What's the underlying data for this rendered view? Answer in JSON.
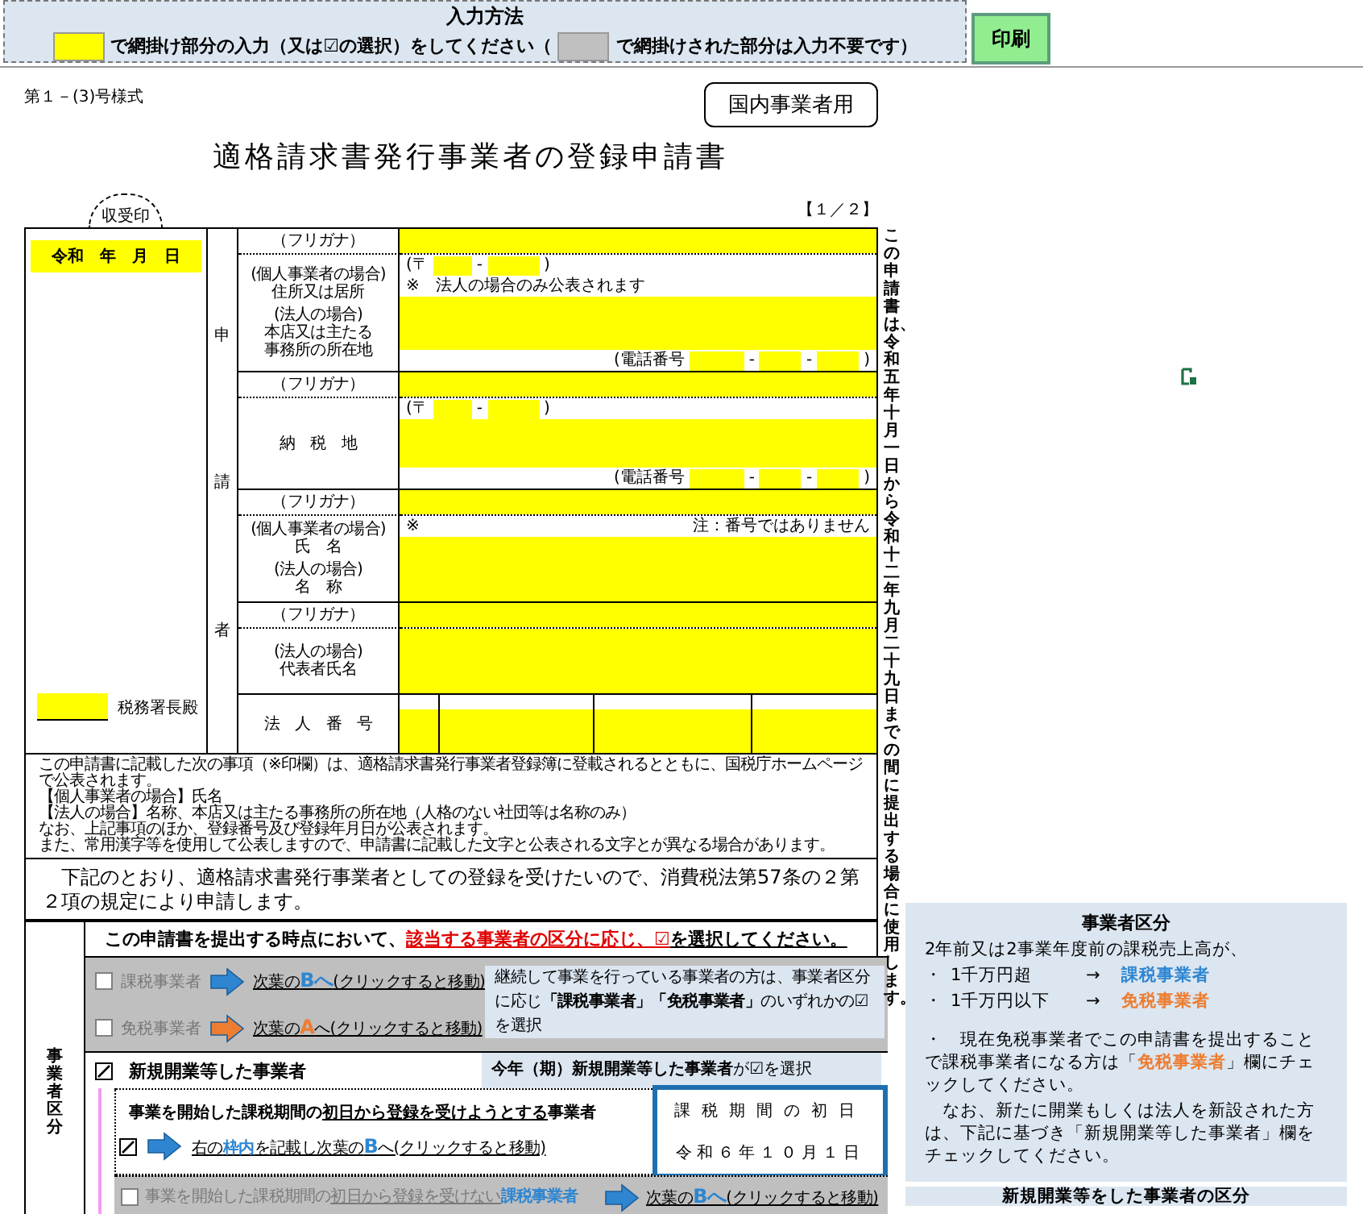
{
  "input_guide": {
    "title": "入力方法",
    "parts": [
      {
        "kind": "swatch",
        "color": "#ffff00"
      },
      {
        "kind": "text",
        "text": "で網掛け部分の入力（又は☑の選択）をしてください（"
      },
      {
        "kind": "swatch",
        "color": "#c0c0c0"
      },
      {
        "kind": "text",
        "text": "で網掛けされた部分は入力不要です）"
      }
    ]
  },
  "print_button": "印刷",
  "form": {
    "form_number": "第１－(3)号様式",
    "category_badge": "国内事業者用",
    "title": "適格請求書発行事業者の登録申請書",
    "stamp": "収受印",
    "page_number": "【１／２】",
    "date_label": "令和　年　月　日",
    "tax_office_suffix": "税務署長殿",
    "applicant_label": [
      "申",
      "請",
      "者"
    ],
    "rows": [
      {
        "kind": "furigana",
        "label_groups": [
          [
            "（フリガナ）"
          ]
        ]
      },
      {
        "kind": "address",
        "label_groups": [
          [
            "(個人事業者の場合)",
            "住所又は居所"
          ],
          [
            "(法人の場合)",
            "本店又は主たる",
            "事務所の所在地"
          ]
        ],
        "postal_prefix": "(〒",
        "postal_separator": "-",
        "postal_suffix": ")",
        "note": "※　法人の場合のみ公表されます",
        "phone_label": "(電話番号",
        "phone_separators": [
          "-",
          "-"
        ],
        "phone_suffix": ")"
      },
      {
        "kind": "furigana",
        "label_groups": [
          [
            "（フリガナ）"
          ]
        ]
      },
      {
        "kind": "address",
        "label_groups": [
          [
            "納　税　地"
          ]
        ],
        "postal_prefix": "(〒",
        "postal_separator": "-",
        "postal_suffix": ")",
        "phone_label": "(電話番号",
        "phone_separators": [
          "-",
          "-"
        ],
        "phone_suffix": ")"
      },
      {
        "kind": "furigana",
        "label_groups": [
          [
            "（フリガナ）"
          ]
        ]
      },
      {
        "kind": "name",
        "label_groups": [
          [
            "(個人事業者の場合)",
            "氏　名"
          ],
          [
            "(法人の場合)",
            "名　称"
          ]
        ],
        "note_mark": "※",
        "note": "注：番号ではありません"
      },
      {
        "kind": "furigana",
        "label_groups": [
          [
            "（フリガナ）"
          ]
        ]
      },
      {
        "kind": "plain",
        "label_groups": [
          [
            "(法人の場合)",
            "代表者氏名"
          ]
        ]
      },
      {
        "kind": "corporate_number",
        "label_groups": [
          [
            "法　人　番　号"
          ]
        ]
      }
    ],
    "side_notice": "この申請書は、令和五年十月一日から令和十二年九月二十九日までの間に提出する場合に使用します。",
    "notes": [
      "この申請書に記載した次の事項（※印欄）は、適格請求書発行事業者登録簿に登載されるとともに、国税庁ホームページで公表されます。",
      "【個人事業者の場合】氏名",
      "【法人の場合】名称、本店又は主たる事務所の所在地（人格のない社団等は名称のみ）",
      "なお、上記事項のほか、登録番号及び登録年月日が公表されます。",
      "また、常用漢字等を使用して公表しますので、申請書に記載した文字と公表される文字とが異なる場合があります。"
    ],
    "declaration": "　下記のとおり、適格請求書発行事業者としての登録を受けたいので、消費税法第57条の２第２項の規定により申請します。",
    "category": {
      "label": "事業者区分",
      "instruction": [
        {
          "kind": "bold",
          "text": "この申請書を提出する時点において、"
        },
        {
          "kind": "red",
          "text": "該当する事業者の区分に応じ、☑"
        },
        {
          "kind": "bold-underline",
          "text": "を選択してください。"
        }
      ],
      "existing_options": [
        {
          "label": "課税事業者",
          "checked": false,
          "color": "#2e86d1",
          "link": [
            {
              "kind": "plain",
              "text": "次葉の"
            },
            {
              "kind": "accent",
              "text": "Bへ"
            },
            {
              "kind": "plain",
              "text": "(クリックすると移動)"
            }
          ]
        },
        {
          "label": "免税事業者",
          "checked": false,
          "color": "#ed7d31",
          "link": [
            {
              "kind": "plain",
              "text": "次葉の"
            },
            {
              "kind": "accent",
              "text": "A"
            },
            {
              "kind": "plain",
              "text": "へ(クリックすると移動)"
            }
          ]
        }
      ],
      "existing_note": [
        {
          "kind": "plain",
          "text": "継続して事業を行っている事業者の方は、事業者区分に応じ"
        },
        {
          "kind": "bold",
          "text": "「課税事業者」「免税事業者」"
        },
        {
          "kind": "plain",
          "text": "のいずれかの☑を選択"
        }
      ],
      "new_business": {
        "label": "新規開業等した事業者",
        "checked": true,
        "note": [
          {
            "kind": "bold",
            "text": "今年（期）新規開業等した事業者"
          },
          {
            "kind": "plain",
            "text": "が☑を選択"
          }
        ]
      },
      "sub_options": [
        {
          "kind": "start_date",
          "checked": true,
          "color": "#2e86d1",
          "title": [
            {
              "kind": "bold",
              "text": "事業を開始した課税期間の"
            },
            {
              "kind": "bold-underline",
              "text": "初日から登録を受けようとする"
            },
            {
              "kind": "bold",
              "text": "事業者"
            }
          ],
          "link": [
            {
              "kind": "plain",
              "text": "右の"
            },
            {
              "kind": "blue",
              "text": "枠内"
            },
            {
              "kind": "plain",
              "text": "を記載し次葉の"
            },
            {
              "kind": "accent",
              "text": "B"
            },
            {
              "kind": "plain",
              "text": "へ(クリックすると移動)"
            }
          ]
        },
        {
          "kind": "no_registration",
          "checked": false,
          "color": "#2e86d1",
          "title": [
            {
              "kind": "plain",
              "text": "事業を開始した課税期間の"
            },
            {
              "kind": "underline",
              "text": "初日から登録を受けない"
            },
            {
              "kind": "blue",
              "text": "課税事業者"
            }
          ],
          "link": [
            {
              "kind": "plain",
              "text": "次葉の"
            },
            {
              "kind": "accent",
              "text": "Bへ"
            },
            {
              "kind": "plain",
              "text": "(クリックすると移動)"
            }
          ]
        }
      ],
      "period_box": {
        "title": "課税期間の初日",
        "value": "令和６年１０月１日"
      }
    }
  },
  "side_panel": {
    "title": "事業者区分",
    "intro": "2年前又は2事業年度前の課税売上高が、",
    "rules": [
      {
        "bullet": "・",
        "condition": "1千万円超",
        "arrow": "→",
        "result": "課税事業者",
        "color": "#2e86d1"
      },
      {
        "bullet": "・",
        "condition": "1千万円以下",
        "arrow": "→",
        "result": "免税事業者",
        "color": "#ed7d31"
      }
    ],
    "advice": [
      {
        "kind": "plain",
        "text": "・　現在免税事業者でこの申請書を提出することで課税事業者になる方は「"
      },
      {
        "kind": "orange",
        "text": "免税事業者"
      },
      {
        "kind": "plain",
        "text": "」欄にチェックしてください。"
      }
    ],
    "advice_2": "　なお、新たに開業もしくは法人を新設された方は、下記に基づき「新規開業等した事業者」欄をチェックしてください。",
    "next_heading": "新規開業等をした事業者の区分"
  }
}
